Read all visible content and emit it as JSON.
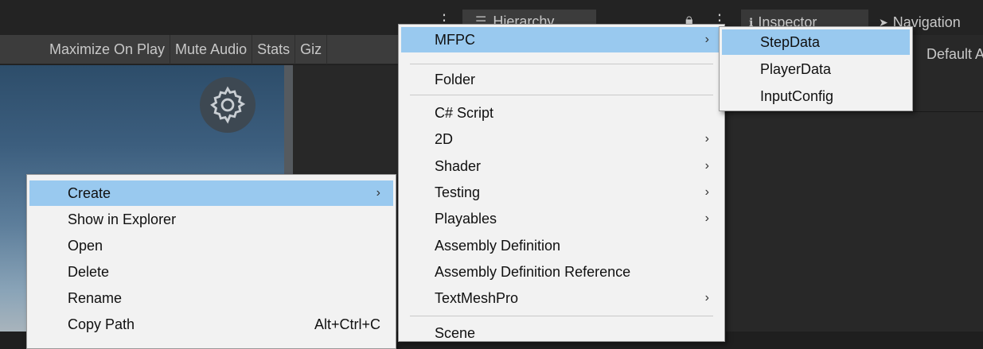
{
  "editor": {
    "game_toolbar": [
      "Maximize On Play",
      "Mute Audio",
      "Stats",
      "Giz"
    ],
    "hierarchy_tab": "Hierarchy",
    "inspector_tab": "Inspector",
    "navigation_tab": "Navigation",
    "inspector_text": "Default A"
  },
  "context_menu": {
    "items": [
      {
        "label": "Create",
        "shortcut": "",
        "arrow": "›"
      },
      {
        "label": "Show in Explorer",
        "shortcut": "",
        "arrow": ""
      },
      {
        "label": "Open",
        "shortcut": "",
        "arrow": ""
      },
      {
        "label": "Delete",
        "shortcut": "",
        "arrow": ""
      },
      {
        "label": "Rename",
        "shortcut": "",
        "arrow": ""
      },
      {
        "label": "Copy Path",
        "shortcut": "Alt+Ctrl+C",
        "arrow": ""
      }
    ]
  },
  "create_menu": {
    "items": [
      {
        "label": "MFPC",
        "arrow": "›"
      },
      {
        "label": "Folder",
        "arrow": ""
      },
      {
        "label": "C# Script",
        "arrow": ""
      },
      {
        "label": "2D",
        "arrow": "›"
      },
      {
        "label": "Shader",
        "arrow": "›"
      },
      {
        "label": "Testing",
        "arrow": "›"
      },
      {
        "label": "Playables",
        "arrow": "›"
      },
      {
        "label": "Assembly Definition",
        "arrow": ""
      },
      {
        "label": "Assembly Definition Reference",
        "arrow": ""
      },
      {
        "label": "TextMeshPro",
        "arrow": "›"
      },
      {
        "label": "Scene",
        "arrow": ""
      }
    ]
  },
  "mfpc_menu": {
    "items": [
      {
        "label": "StepData"
      },
      {
        "label": "PlayerData"
      },
      {
        "label": "InputConfig"
      }
    ]
  },
  "colors": {
    "menu_bg": "#f2f2f2",
    "highlight": "#99c9ef",
    "editor_dark": "#282828",
    "toolbar": "#3c3c3c"
  },
  "icons": {
    "scene_gizmo": "gear-icon",
    "hierarchy": "hierarchy-list-icon",
    "lock": "lock-icon",
    "inspector": "info-icon",
    "navigation": "navigation-icon",
    "submenu": "chevron-right-icon"
  }
}
